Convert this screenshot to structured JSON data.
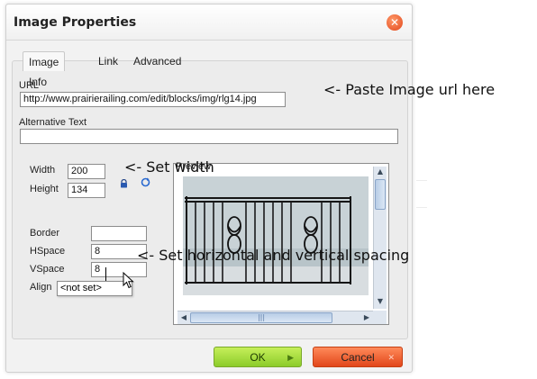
{
  "dialog": {
    "title": "Image Properties",
    "close_icon": "close-icon"
  },
  "tabs": [
    {
      "label": "Image Info",
      "active": true
    },
    {
      "label": "Link",
      "active": false
    },
    {
      "label": "Advanced",
      "active": false
    }
  ],
  "fields": {
    "url_label": "URL",
    "url_value": "http://www.prairierailing.com/edit/blocks/img/rlg14.jpg",
    "alt_label": "Alternative Text",
    "alt_value": "",
    "width_label": "Width",
    "width_value": "200",
    "height_label": "Height",
    "height_value": "134",
    "border_label": "Border",
    "border_value": "",
    "hspace_label": "HSpace",
    "hspace_value": "8",
    "vspace_label": "VSpace",
    "vspace_value": "8",
    "align_label": "Align",
    "align_value": "<not set>"
  },
  "icons": {
    "lock": "lock-icon",
    "reset": "reset-icon"
  },
  "preview": {
    "label": "Preview"
  },
  "annotations": {
    "url": "<- Paste Image url here",
    "width": "<- Set width",
    "spacing": "<- Set horizontal and vertical spacing"
  },
  "buttons": {
    "ok": "OK",
    "cancel": "Cancel"
  },
  "colors": {
    "ok_button": "#a6dd3c",
    "cancel_button": "#f05a24",
    "close_button": "#e85a2a"
  }
}
